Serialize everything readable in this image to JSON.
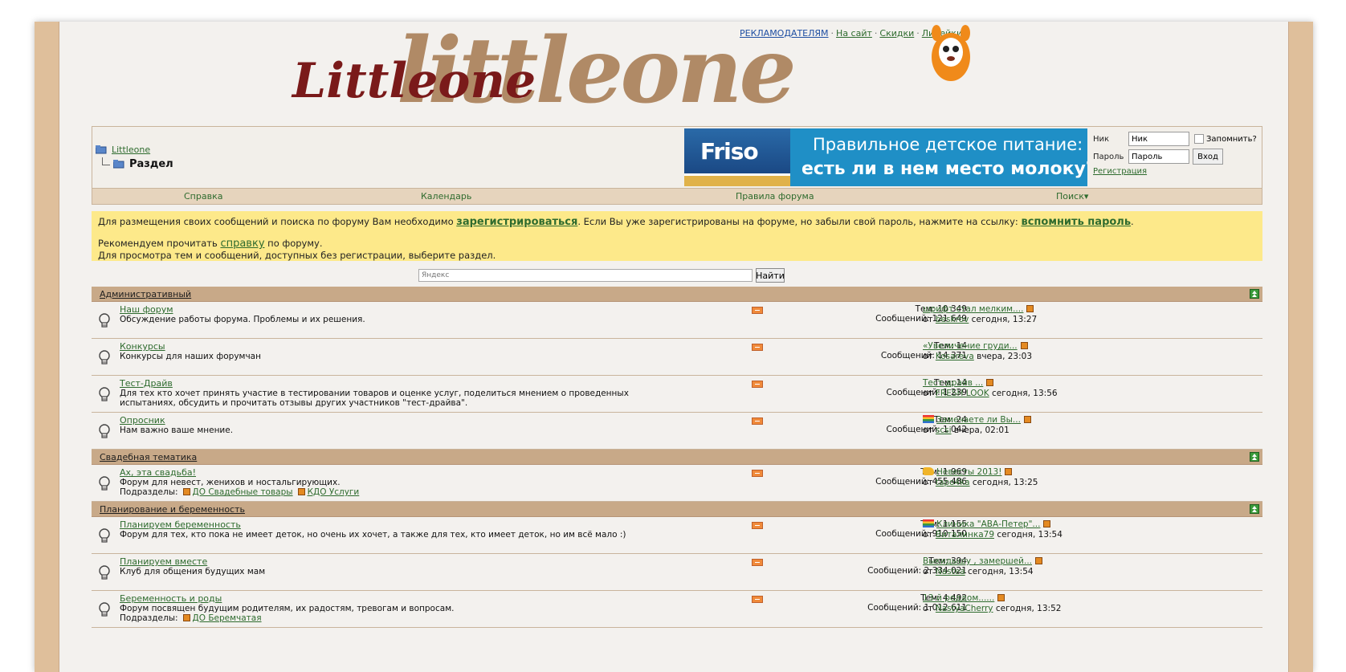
{
  "top_links": {
    "advertisers": "РЕКЛАМОДАТЕЛЯМ",
    "to_site": "На сайт",
    "discounts": "Скидки",
    "lines": "Линейки",
    "separator": "·"
  },
  "logo": {
    "script_text": "Littleone",
    "big_text": "littleone"
  },
  "breadcrumb": {
    "root": "Littleone",
    "current": "Раздел"
  },
  "banner": {
    "brand": "Friso",
    "line1": "Правильное детское питание:",
    "line2": "есть ли в нем место молоку?"
  },
  "login": {
    "nick_label": "Ник",
    "nick_value": "Ник",
    "remember_label": "Запомнить?",
    "password_label": "Пароль",
    "password_value": "Пароль",
    "login_button": "Вход",
    "register_link": "Регистрация"
  },
  "nav": {
    "help": "Справка",
    "calendar": "Календарь",
    "rules": "Правила форума",
    "search": "Поиск"
  },
  "notice": {
    "p1_before": "Для размещения своих сообщений и поиска по форуму Вам необходимо ",
    "p1_register": "зарегистрироваться",
    "p1_middle": ". Если Вы уже зарегистрированы на форуме, но забыли свой пароль, нажмите на ссылку: ",
    "p1_remind": "вспомнить пароль",
    "p1_end": ".",
    "p2_before": "Рекомендуем прочитать ",
    "p2_help": "справку",
    "p2_after": " по форуму.",
    "p3": "Для просмотра тем и сообщений, доступных без регистрации, выберите раздел."
  },
  "search": {
    "placeholder": "Яндекс",
    "button": "Найти"
  },
  "colors": {
    "category_bar": "#c8a988",
    "notice_bg": "#fde98a",
    "link_green": "#2e6b2e",
    "frame_tan": "#dfbf9b"
  },
  "categories": [
    {
      "title": "Административный",
      "forums": [
        {
          "name": "Наш форум",
          "desc": "Обсуждение работы форума. Проблемы и их решения.",
          "topics": "Тем: 10 349",
          "posts": "Сообщений: 121 649",
          "last_title": "шрифт стал мелким....",
          "last_from": "от",
          "last_user": "beskrov",
          "last_time": "сегодня, 13:27"
        },
        {
          "name": "Конкурсы",
          "desc": "Конкурсы для наших форумчан",
          "topics": "Тем: 14",
          "posts": "Сообщений: 14 371",
          "last_title": "«Увеличение груди...",
          "last_from": "от",
          "last_user": "Kosareva",
          "last_time": "вчера, 23:03"
        },
        {
          "name": "Тест-Драйв",
          "desc": "Для тех кто хочет принять участие в тестировании товаров и оценке услуг, поделиться мнением о проведенных испытаниях, обсудить и прочитать отзывы других участников \"тест-драйва\".",
          "topics": "Тем: 14",
          "posts": "Сообщений: 1 239",
          "last_title": "Тест-драйв ...",
          "last_from": "от",
          "last_user": "FRESH LOOK",
          "last_time": "сегодня, 13:56"
        },
        {
          "name": "Опросник",
          "desc": "Нам важно ваше мнение.",
          "topics": "Тем: 24",
          "posts": "Сообщений: 1 042",
          "last_title": "Замечаете ли Вы...",
          "last_from": "от",
          "last_user": "scsi",
          "last_time": "вчера, 02:01",
          "icon": "bars"
        }
      ]
    },
    {
      "title": "Свадебная тематика",
      "forums": [
        {
          "name": "Ах, эта свадьба!",
          "desc": "Форум для невест, женихов и ностальгирующих.",
          "subs_label": "Подразделы:",
          "subs": [
            "ДО Свадебные товары",
            "КДО Услуги"
          ],
          "topics": "Тем: 1 969",
          "posts": "Сообщений: 455 486",
          "last_title": "Невесты 2013!",
          "last_from": "от",
          "last_user": "tapo4ka",
          "last_time": "сегодня, 13:25",
          "icon": "thumb"
        }
      ]
    },
    {
      "title": "Планирование и беременность",
      "forums": [
        {
          "name": "Планируем беременность",
          "desc": "Форум для тех, кто пока не имеет деток, но очень их хочет, а также для тех, кто имеет деток, но им всё мало :)",
          "topics": "Тем: 1 155",
          "posts": "Сообщений: 910 150",
          "last_title": "Клиника \"АВА-Петер\"...",
          "last_from": "от",
          "last_user": "Виталинка79",
          "last_time": "сегодня, 13:54",
          "icon": "bars"
        },
        {
          "name": "Планируем вместе",
          "desc": "Клуб для общения будущих мам",
          "topics": "Тем: 394",
          "posts": "Сообщений: 2 334 021",
          "last_title": "Выкидышу , замершей...",
          "last_from": "от",
          "last_user": "Nastea",
          "last_time": "сегодня, 13:54"
        },
        {
          "name": "Беременность и роды",
          "desc": "Форум посвящен будущим родителям, их радостям, тревогам и вопросам.",
          "subs_label": "Подразделы:",
          "subs": [
            "ДО Беремчатая"
          ],
          "topics": "Тем: 4 492",
          "posts": "Сообщений: 1 012 611",
          "last_title": "13-й роддом......",
          "last_from": "от",
          "last_user": "NastyaCherry",
          "last_time": "сегодня, 13:52"
        }
      ]
    }
  ]
}
